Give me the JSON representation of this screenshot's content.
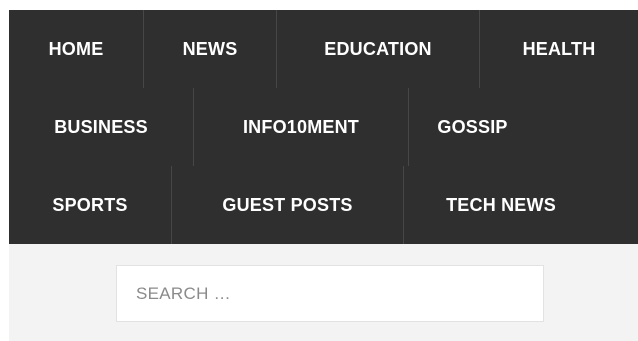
{
  "nav": {
    "row1": [
      "HOME",
      "NEWS",
      "EDUCATION",
      "HEALTH"
    ],
    "row2": [
      "BUSINESS",
      "INFO10MENT",
      "GOSSIP"
    ],
    "row3": [
      "SPORTS",
      "GUEST POSTS",
      "TECH NEWS"
    ]
  },
  "search": {
    "placeholder": "SEARCH …",
    "value": ""
  },
  "colors": {
    "nav_background": "#2f2f2f",
    "nav_text": "#ffffff",
    "search_band": "#f3f3f3"
  }
}
